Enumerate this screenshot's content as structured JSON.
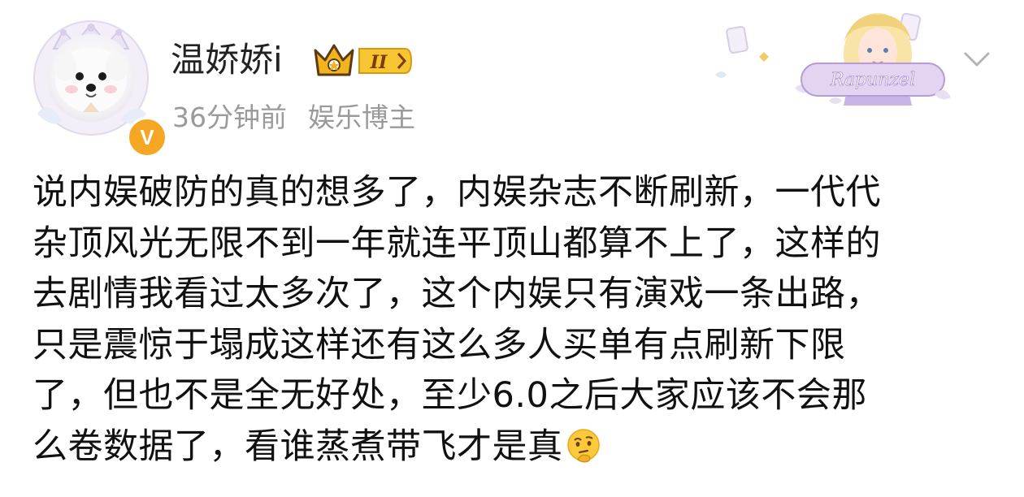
{
  "post": {
    "username": "温娇娇i",
    "level_badge": "II",
    "avatar_verified_badge": "V",
    "time": "36分钟前",
    "role": "娱乐博主",
    "deco_text": "Rapunzel",
    "body_lines": [
      "说内娱破防的真的想多了，内娱杂志不断刷新，一代代",
      "杂顶风光无限不到一年就连平顶山都算不上了，这样的",
      "去剧情我看过太多次了，这个内娱只有演戏一条出路，",
      "只是震惊于塌成这样还有这么多人买单有点刷新下限",
      "了，但也不是全无好处，至少6.0之后大家应该不会那",
      "么卷数据了，看谁蒸煮带飞才是真"
    ],
    "trailing_emoji": "thinking-face-icon",
    "colors": {
      "text": "#111111",
      "meta": "#9a9a9a",
      "verified": "#f5a623",
      "crown": "#f2b41c"
    }
  }
}
